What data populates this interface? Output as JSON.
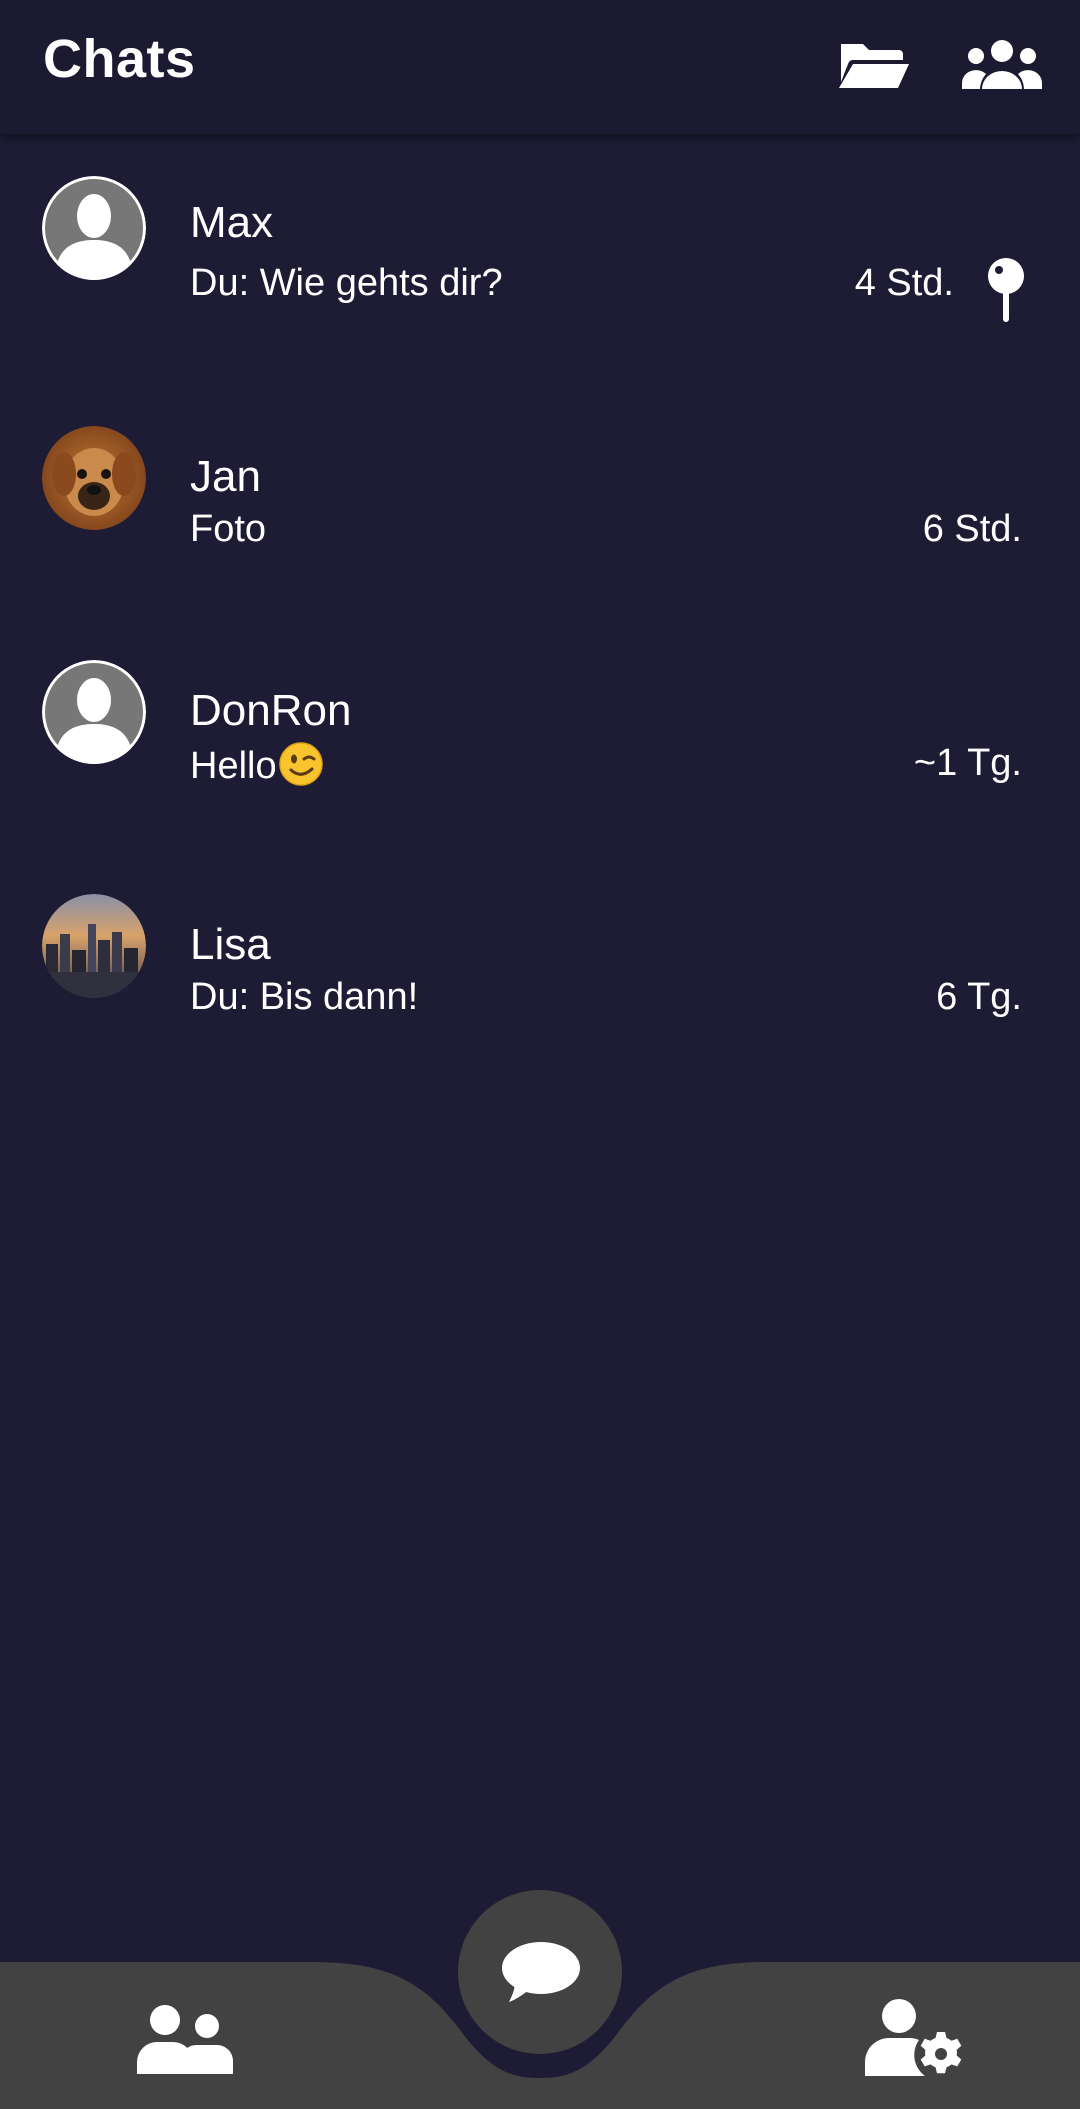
{
  "header": {
    "title": "Chats",
    "folder_icon": "folder-open-icon",
    "groups_icon": "users-group-icon"
  },
  "chats": [
    {
      "name": "Max",
      "preview": "Du: Wie gehts dir?",
      "time": "4 Std.",
      "pinned": true,
      "avatar": "default-person-avatar"
    },
    {
      "name": "Jan",
      "preview": "Foto",
      "time": "6 Std.",
      "pinned": false,
      "avatar": "dog-photo-avatar"
    },
    {
      "name": "DonRon",
      "preview": "Hello",
      "preview_emoji": "winking-face-emoji",
      "time": "~1 Tg.",
      "pinned": false,
      "avatar": "default-person-avatar"
    },
    {
      "name": "Lisa",
      "preview": "Du: Bis dann!",
      "time": "6 Tg.",
      "pinned": false,
      "avatar": "city-skyline-photo-avatar"
    }
  ],
  "bottom_nav": {
    "left_icon": "contacts-icon",
    "center_icon": "chat-bubble-icon",
    "right_icon": "user-settings-icon"
  },
  "colors": {
    "background": "#1d1c34",
    "header": "#1b1a31",
    "nav_bar": "#424242",
    "text": "#ffffff",
    "avatar_default": "#777777"
  }
}
